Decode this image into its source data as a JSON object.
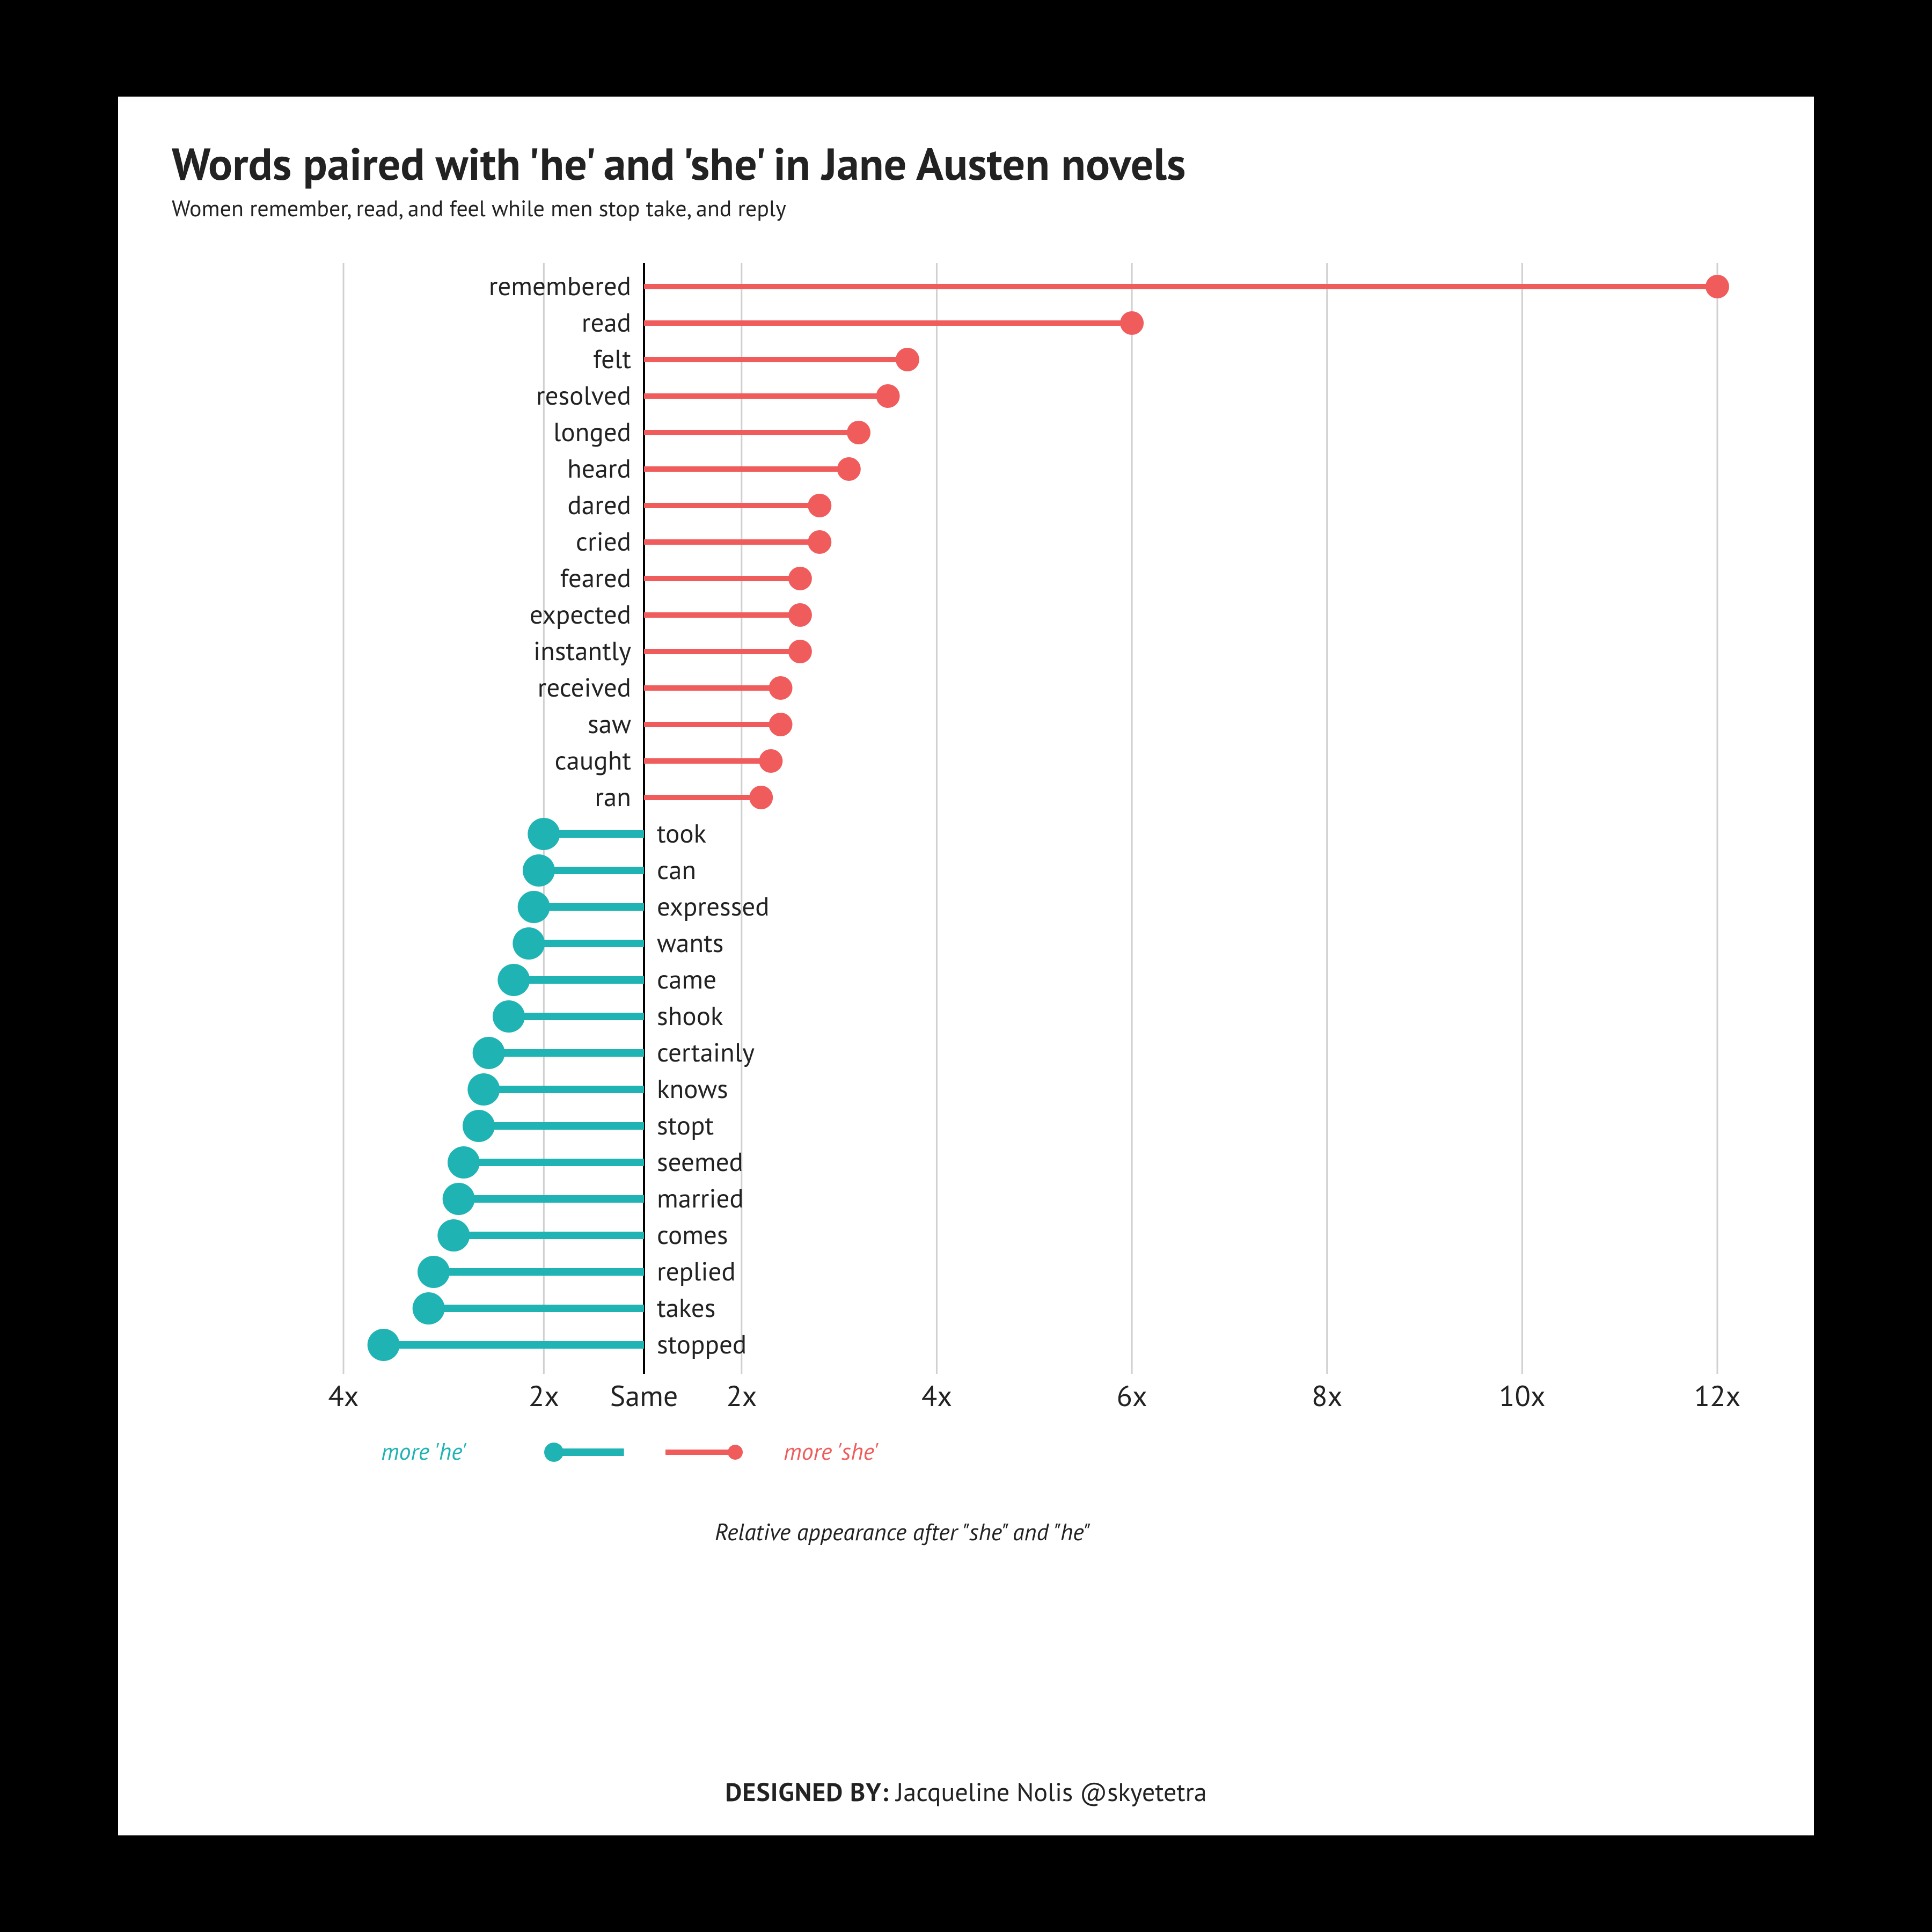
{
  "title": "Words paired with 'he' and 'she' in Jane Austen novels",
  "subtitle": "Women remember, read, and feel while men stop take, and reply",
  "legend": {
    "he": "more 'he'",
    "she": "more 'she'"
  },
  "caption": "Relative appearance after \"she\" and \"he\"",
  "credit_label": "DESIGNED BY:",
  "credit_value": "Jacqueline Nolis @skyetetra",
  "chart_data": {
    "type": "bar",
    "xlabel": "Relative appearance after \"she\" and \"he\"",
    "x_ticks_he": [
      2,
      4
    ],
    "x_ticks_she": [
      2,
      4,
      6,
      8,
      10,
      12
    ],
    "x_center_label": "Same",
    "she_series": [
      {
        "word": "remembered",
        "value": 12.0
      },
      {
        "word": "read",
        "value": 6.0
      },
      {
        "word": "felt",
        "value": 3.7
      },
      {
        "word": "resolved",
        "value": 3.5
      },
      {
        "word": "longed",
        "value": 3.2
      },
      {
        "word": "heard",
        "value": 3.1
      },
      {
        "word": "dared",
        "value": 2.8
      },
      {
        "word": "cried",
        "value": 2.8
      },
      {
        "word": "feared",
        "value": 2.6
      },
      {
        "word": "expected",
        "value": 2.6
      },
      {
        "word": "instantly",
        "value": 2.6
      },
      {
        "word": "received",
        "value": 2.4
      },
      {
        "word": "saw",
        "value": 2.4
      },
      {
        "word": "caught",
        "value": 2.3
      },
      {
        "word": "ran",
        "value": 2.2
      }
    ],
    "he_series": [
      {
        "word": "took",
        "value": 2.0
      },
      {
        "word": "can",
        "value": 2.05
      },
      {
        "word": "expressed",
        "value": 2.1
      },
      {
        "word": "wants",
        "value": 2.15
      },
      {
        "word": "came",
        "value": 2.3
      },
      {
        "word": "shook",
        "value": 2.35
      },
      {
        "word": "certainly",
        "value": 2.55
      },
      {
        "word": "knows",
        "value": 2.6
      },
      {
        "word": "stopt",
        "value": 2.65
      },
      {
        "word": "seemed",
        "value": 2.8
      },
      {
        "word": "married",
        "value": 2.85
      },
      {
        "word": "comes",
        "value": 2.9
      },
      {
        "word": "replied",
        "value": 3.1
      },
      {
        "word": "takes",
        "value": 3.15
      },
      {
        "word": "stopped",
        "value": 3.6
      }
    ]
  }
}
